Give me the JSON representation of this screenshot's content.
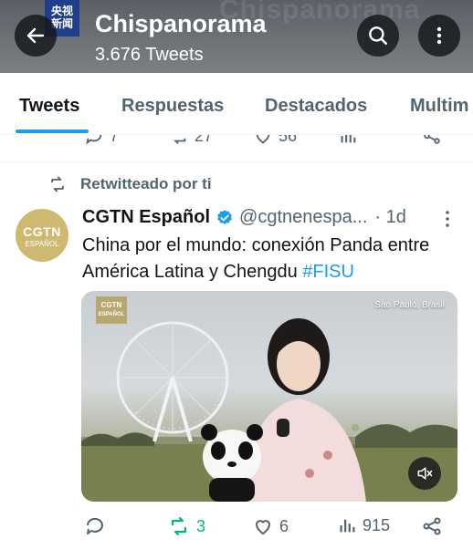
{
  "header": {
    "watermark_top": "央视",
    "watermark_bottom": "新闻",
    "bg_text": "Chispanorama",
    "title": "Chispanorama",
    "subtitle": "3.676 Tweets"
  },
  "tabs": [
    {
      "label": "Tweets",
      "active": true
    },
    {
      "label": "Respuestas",
      "active": false
    },
    {
      "label": "Destacados",
      "active": false
    },
    {
      "label": "Multim",
      "active": false
    }
  ],
  "prev_tweet_actions": {
    "replies": "7",
    "retweets": "27",
    "likes": "56"
  },
  "tweet": {
    "retweet_notice": "Retwitteado por ti",
    "avatar_text": "CGTN",
    "avatar_subtext": "ESPAÑOL",
    "author": "CGTN Español",
    "handle": "@cgtnenespa...",
    "time": "· 1d",
    "text": "China por el mundo: conexión Panda entre América Latina y Chengdu ",
    "hashtag": "#FISU",
    "media": {
      "logo_text_top": "CGTN",
      "logo_text_bottom": "ESPAÑOL",
      "location": "Sao Paulo, Brasil"
    },
    "actions": {
      "retweets": "3",
      "likes": "6",
      "views": "915"
    }
  },
  "colors": {
    "accent": "#1d9bf0",
    "retweet": "#00ba7c",
    "muted": "#536471",
    "verified": "#1d9bf0"
  }
}
